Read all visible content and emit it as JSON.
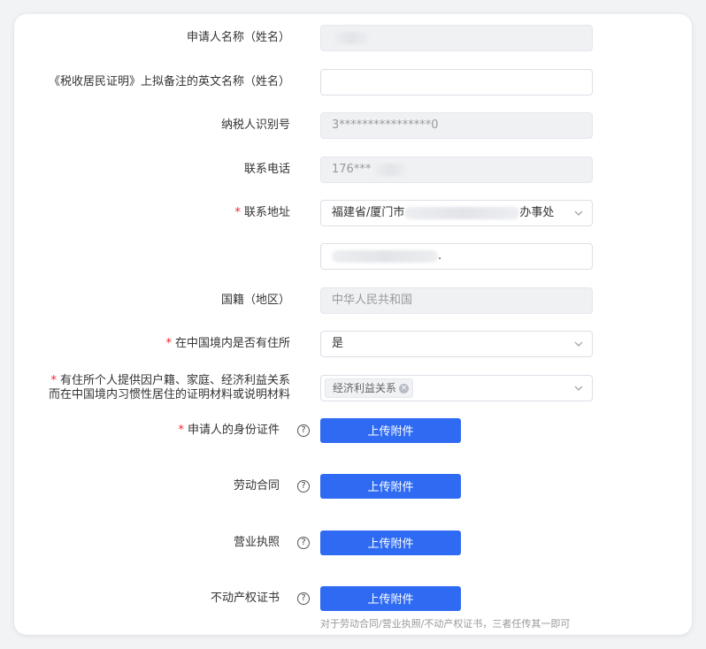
{
  "form": {
    "applicant_name": {
      "label": "申请人名称（姓名）",
      "value": ""
    },
    "english_name": {
      "label": "《税收居民证明》上拟备注的英文名称（姓名）",
      "value": ""
    },
    "taxpayer_id": {
      "label": "纳税人识别号",
      "value": "3****************0"
    },
    "phone": {
      "label": "联系电话",
      "value": "176***"
    },
    "address": {
      "label": "联系地址",
      "required": "*",
      "value_prefix": "福建省/厦门市",
      "value_suffix": "办事处"
    },
    "address_detail": {
      "value": "."
    },
    "nationality": {
      "label": "国籍（地区）",
      "value": "中华人民共和国"
    },
    "has_residence": {
      "label": "在中国境内是否有住所",
      "required": "*",
      "value": "是"
    },
    "proof_materials": {
      "label_line1": "有住所个人提供因户籍、家庭、经济利益关系",
      "label_line2": "而在中国境内习惯性居住的证明材料或说明材料",
      "required": "*",
      "tag": "经济利益关系",
      "tag_close": "×"
    },
    "id_document": {
      "label": "申请人的身份证件",
      "required": "*",
      "button": "上传附件"
    },
    "labor_contract": {
      "label": "劳动合同",
      "button": "上传附件"
    },
    "business_license": {
      "label": "营业执照",
      "button": "上传附件"
    },
    "property_cert": {
      "label": "不动产权证书",
      "button": "上传附件"
    },
    "hint": "对于劳动合同/营业执照/不动产权证书，三者任传其一即可",
    "help_glyph": "?"
  },
  "colors": {
    "primary": "#2f6bf2",
    "required": "#f5222d",
    "disabled_bg": "#f0f1f3"
  },
  "icons": {
    "dropdown": "chevron-down-icon",
    "help": "question-circle-icon",
    "tag_remove": "close-icon"
  }
}
